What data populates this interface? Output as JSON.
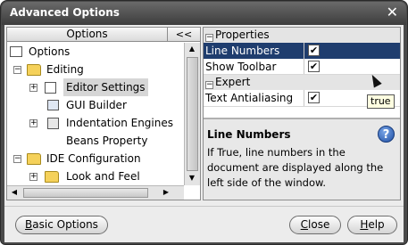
{
  "window": {
    "title": "Advanced Options",
    "close_glyph": "✕"
  },
  "left_panel": {
    "header": "Options",
    "collapse_label": "<<",
    "tree": [
      {
        "label": "Options",
        "icon": "options-icon",
        "level": 0
      },
      {
        "label": "Editing",
        "icon": "folder-icon",
        "level": 1,
        "expanded": true
      },
      {
        "label": "Editor Settings",
        "icon": "editor-settings-icon",
        "level": 2,
        "selected": true
      },
      {
        "label": "GUI Builder",
        "icon": "gui-builder-icon",
        "level": 2
      },
      {
        "label": "Indentation Engines",
        "icon": "indentation-icon",
        "level": 2
      },
      {
        "label": "Beans Property",
        "icon": "",
        "level": 2
      },
      {
        "label": "IDE Configuration",
        "icon": "folder-icon",
        "level": 1,
        "expanded": true
      },
      {
        "label": "Look and Feel",
        "icon": "folder-icon",
        "level": 2
      }
    ]
  },
  "properties": {
    "categories": [
      {
        "name": "Properties",
        "expander": "−"
      },
      {
        "name": "Expert",
        "expander": "−"
      }
    ],
    "rows": [
      {
        "name": "Line Numbers",
        "checked": true,
        "check_glyph": "✔",
        "selected": true
      },
      {
        "name": "Show Toolbar",
        "checked": true,
        "check_glyph": "✔"
      },
      {
        "name": "Text Antialiasing",
        "checked": true,
        "check_glyph": "✔"
      }
    ],
    "tooltip": "true"
  },
  "description": {
    "title": "Line Numbers",
    "text": "If True, line numbers in the document are displayed along the left side of the window.",
    "help_glyph": "?"
  },
  "buttons": {
    "basic": {
      "mnemonic": "B",
      "rest": "asic Options"
    },
    "close": {
      "mnemonic": "C",
      "rest": "lose"
    },
    "help": {
      "mnemonic": "H",
      "rest": "elp"
    }
  }
}
